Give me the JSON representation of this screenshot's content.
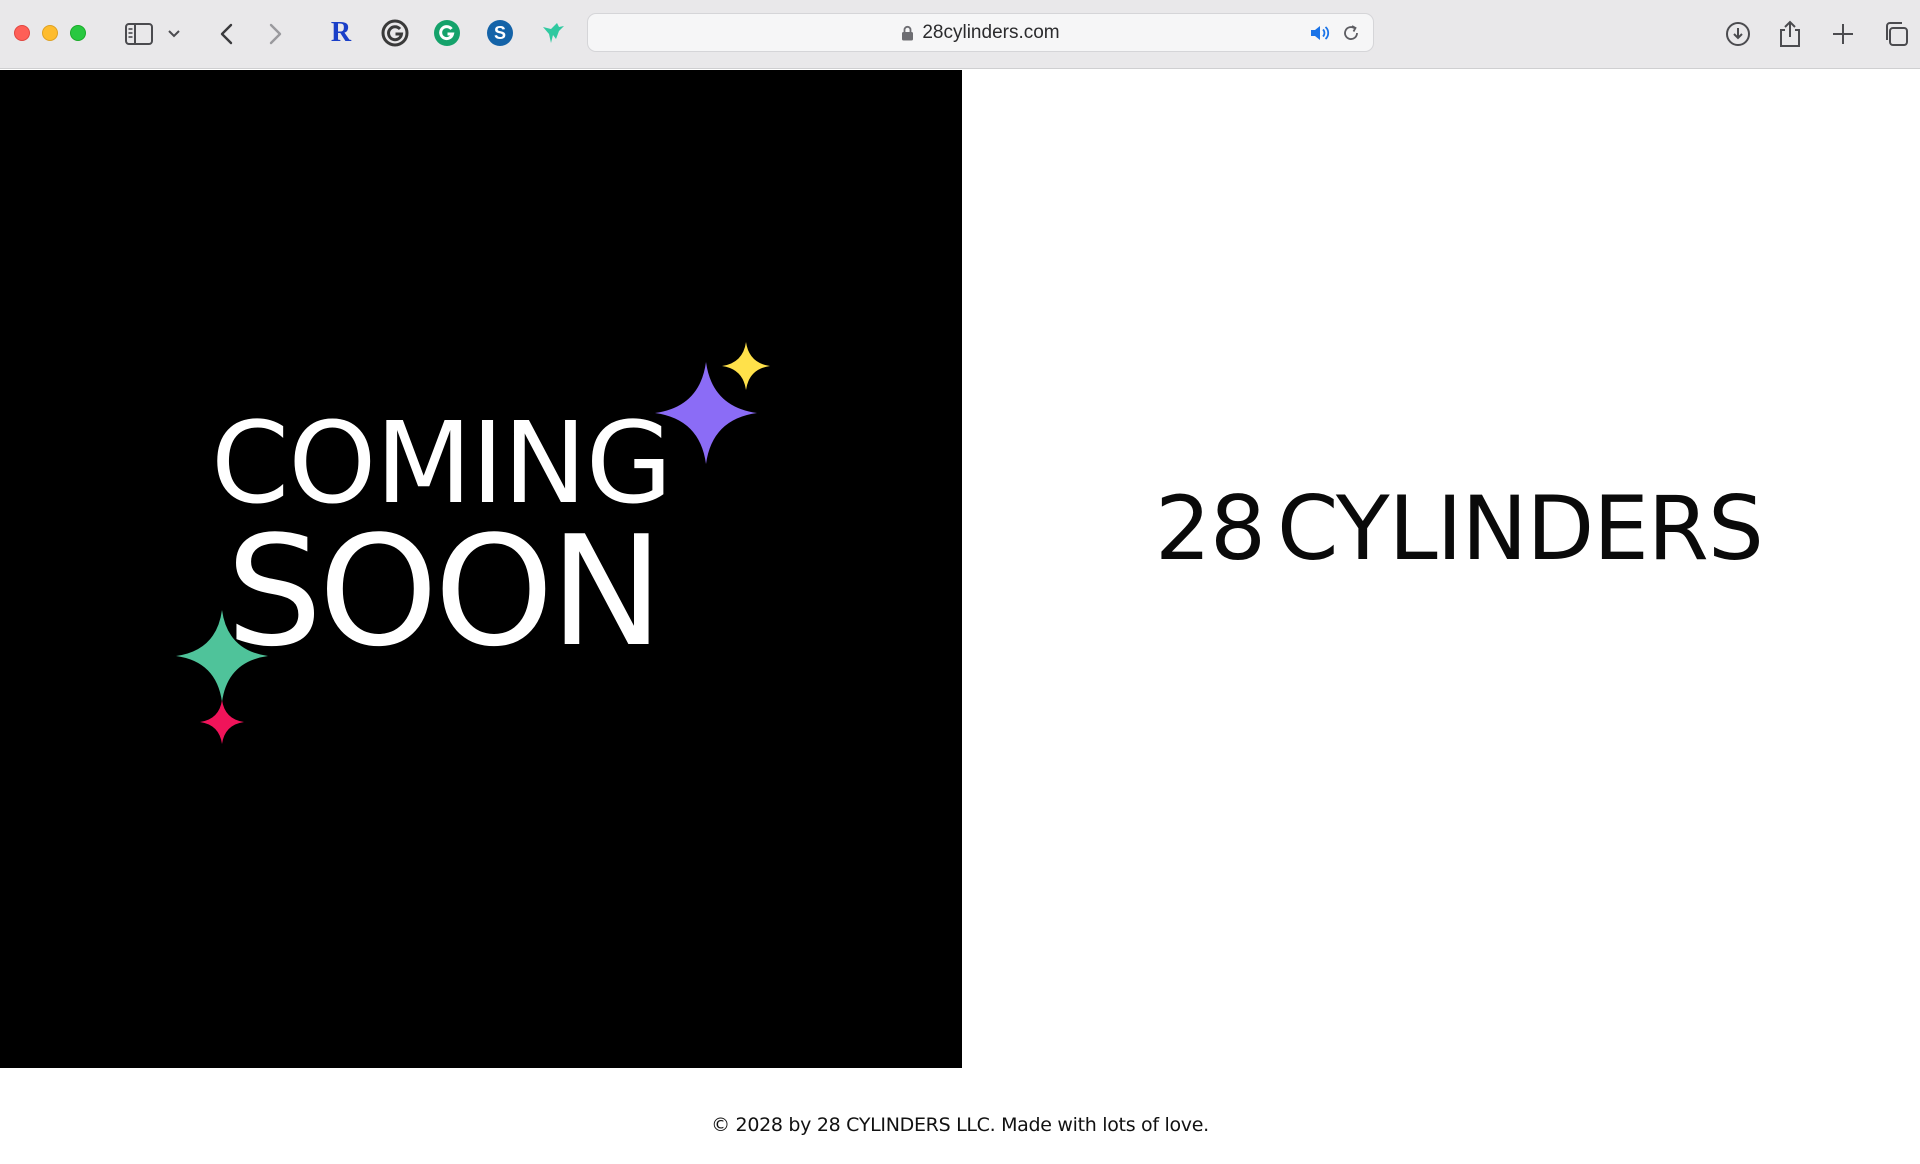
{
  "browser": {
    "url": "28cylinders.com",
    "extensions": [
      {
        "name": "r-extension-icon",
        "label": "R"
      },
      {
        "name": "g-outline-extension-icon",
        "label": "G"
      },
      {
        "name": "grammarly-icon",
        "label": "G"
      },
      {
        "name": "s-extension-icon",
        "label": "S"
      },
      {
        "name": "bird-extension-icon",
        "label": ""
      }
    ],
    "colors": {
      "toolbar": "#e9e8ea",
      "accent": "#1a73e8"
    }
  },
  "hero": {
    "line1": "COMING",
    "line2": "SOON",
    "sparkle_colors": [
      "#ffe14a",
      "#8b6cf6",
      "#4fc39a",
      "#f0145a"
    ]
  },
  "brand": {
    "number": "28",
    "name": "CYLINDERS"
  },
  "footer": {
    "text": "© 2028 by 28 CYLINDERS LLC. Made with lots of love."
  }
}
